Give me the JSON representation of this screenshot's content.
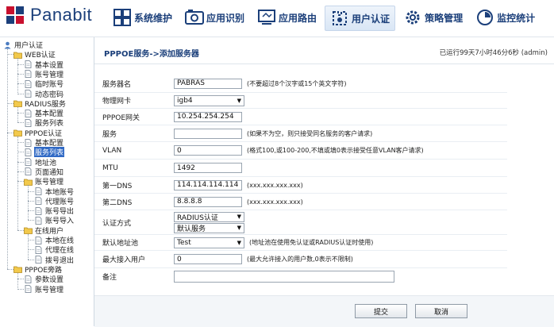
{
  "app": {
    "logo_text": "Panabit"
  },
  "nav": [
    {
      "label": "系统维护",
      "icon": "system-maintenance-icon"
    },
    {
      "label": "应用识别",
      "icon": "app-recognition-icon"
    },
    {
      "label": "应用路由",
      "icon": "app-routing-icon"
    },
    {
      "label": "用户认证",
      "icon": "user-auth-icon",
      "active": true
    },
    {
      "label": "策略管理",
      "icon": "policy-gear-icon"
    },
    {
      "label": "监控统计",
      "icon": "monitor-stats-icon"
    }
  ],
  "tree": [
    {
      "label": "用户认证",
      "level": 0,
      "type": "root"
    },
    {
      "label": "WEB认证",
      "level": 1,
      "type": "folder"
    },
    {
      "label": "基本设置",
      "level": 2,
      "type": "doc"
    },
    {
      "label": "账号管理",
      "level": 2,
      "type": "doc"
    },
    {
      "label": "临时账号",
      "level": 2,
      "type": "doc"
    },
    {
      "label": "动态密码",
      "level": 2,
      "type": "doc"
    },
    {
      "label": "RADIUS服务",
      "level": 1,
      "type": "folder"
    },
    {
      "label": "基本配置",
      "level": 2,
      "type": "doc"
    },
    {
      "label": "服务列表",
      "level": 2,
      "type": "doc"
    },
    {
      "label": "PPPOE认证",
      "level": 1,
      "type": "folder"
    },
    {
      "label": "基本配置",
      "level": 2,
      "type": "doc"
    },
    {
      "label": "服务列表",
      "level": 2,
      "type": "doc",
      "selected": true
    },
    {
      "label": "地址池",
      "level": 2,
      "type": "doc"
    },
    {
      "label": "页面通知",
      "level": 2,
      "type": "doc"
    },
    {
      "label": "账号管理",
      "level": 2,
      "type": "folder"
    },
    {
      "label": "本地账号",
      "level": 3,
      "type": "doc"
    },
    {
      "label": "代理账号",
      "level": 3,
      "type": "doc"
    },
    {
      "label": "账号导出",
      "level": 3,
      "type": "doc"
    },
    {
      "label": "账号导入",
      "level": 3,
      "type": "doc"
    },
    {
      "label": "在线用户",
      "level": 2,
      "type": "folder"
    },
    {
      "label": "本地在线",
      "level": 3,
      "type": "doc"
    },
    {
      "label": "代理在线",
      "level": 3,
      "type": "doc"
    },
    {
      "label": "拨号退出",
      "level": 3,
      "type": "doc"
    },
    {
      "label": "PPPOE旁路",
      "level": 1,
      "type": "folder"
    },
    {
      "label": "参数设置",
      "level": 2,
      "type": "doc"
    },
    {
      "label": "账号管理",
      "level": 2,
      "type": "doc"
    }
  ],
  "page": {
    "title": "PPPOE服务->添加服务器",
    "uptime": "已运行99天7小时46分6秒 (admin)"
  },
  "form": {
    "server_name": {
      "label": "服务器名",
      "value": "PABRAS",
      "hint": "(不要超过8个汉字或15个英文字符)"
    },
    "physical_nic": {
      "label": "物理网卡",
      "value": "igb4"
    },
    "gateway": {
      "label": "PPPOE网关",
      "value": "10.254.254.254"
    },
    "service": {
      "label": "服务",
      "value": "",
      "hint": "(如果不为空，则只接受同名服务的客户请求)"
    },
    "vlan": {
      "label": "VLAN",
      "value": "0",
      "hint": "(格式100,或100-200,不填或填0表示接受任意VLAN客户请求)"
    },
    "mtu": {
      "label": "MTU",
      "value": "1492"
    },
    "dns1": {
      "label": "第一DNS",
      "value": "114.114.114.114",
      "hint": "(xxx.xxx.xxx.xxx)"
    },
    "dns2": {
      "label": "第二DNS",
      "value": "8.8.8.8",
      "hint": "(xxx.xxx.xxx.xxx)"
    },
    "auth_method": {
      "label": "认证方式",
      "value1": "RADIUS认证",
      "value2": "默认服务"
    },
    "default_pool": {
      "label": "默认地址池",
      "value": "Test",
      "hint": "(地址池在使用免认证或RADIUS认证时使用)"
    },
    "max_users": {
      "label": "最大接入用户",
      "value": "0",
      "hint": "(最大允许接入的用户数,0表示不限制)"
    },
    "remark": {
      "label": "备注",
      "value": ""
    }
  },
  "buttons": {
    "submit": "提交",
    "cancel": "取消"
  },
  "colors": {
    "brand": "#1b3f7a",
    "selected": "#316ac5",
    "folder": "#f2c94c"
  }
}
